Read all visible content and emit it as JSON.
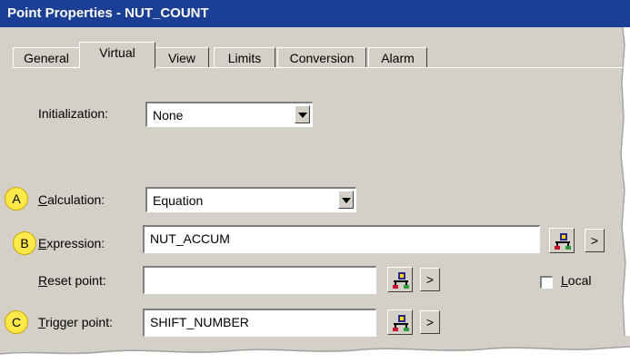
{
  "window": {
    "title": "Point Properties - NUT_COUNT"
  },
  "tabs": [
    {
      "label": "General",
      "active": false
    },
    {
      "label": "Virtual",
      "active": true
    },
    {
      "label": "View",
      "active": false
    },
    {
      "label": "Limits",
      "active": false
    },
    {
      "label": "Conversion",
      "active": false
    },
    {
      "label": "Alarm",
      "active": false
    }
  ],
  "initialization": {
    "label": "Initialization:",
    "value": "None"
  },
  "calculation": {
    "badge": "A",
    "label_mnemonic": "C",
    "label_rest": "alculation:",
    "value": "Equation"
  },
  "expression": {
    "badge": "B",
    "label_mnemonic": "E",
    "label_rest": "xpression:",
    "value": "NUT_ACCUM",
    "arrow": ">"
  },
  "reset_point": {
    "label_mnemonic": "R",
    "label_rest": "eset point:",
    "value": "",
    "arrow": ">"
  },
  "local": {
    "label_mnemonic": "L",
    "label_rest": "ocal",
    "checked": false
  },
  "trigger_point": {
    "badge": "C",
    "label_mnemonic": "T",
    "label_rest": "rigger point:",
    "value": "SHIFT_NUMBER",
    "arrow": ">"
  },
  "colors": {
    "titlebar": "#1c3f96",
    "dialog": "#d4d0c8",
    "badge": "#ffe94a"
  }
}
